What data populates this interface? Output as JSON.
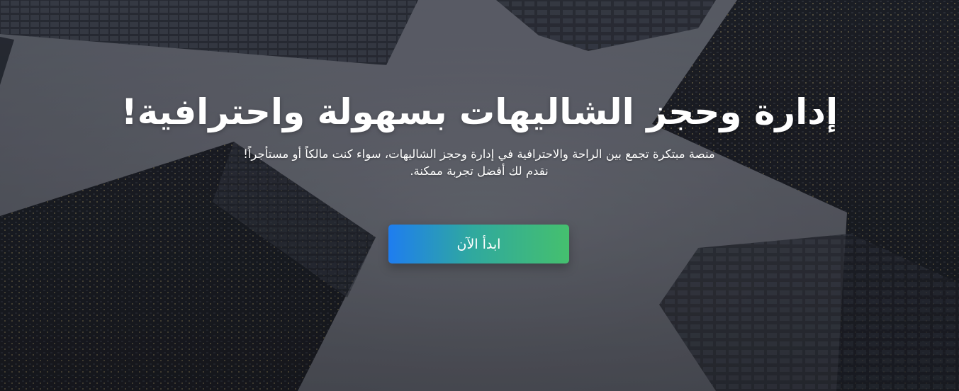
{
  "hero": {
    "title": "إدارة وحجز الشاليهات بسهولة واحترافية!",
    "subtitle_line1": "منصة مبتكرة تجمع بين الراحة والاحترافية في إدارة وحجز الشاليهات، سواء كنت مالكاً أو مستأجراً!",
    "subtitle_line2": "نقدم لك أفضل تجربة ممكنة.",
    "cta_label": "ابدأ الآن",
    "background": "skyscrapers-looking-up-photo"
  },
  "colors": {
    "text": "#ffffff",
    "button_gradient_start": "#1e7df0",
    "button_gradient_end": "#45c06e"
  }
}
